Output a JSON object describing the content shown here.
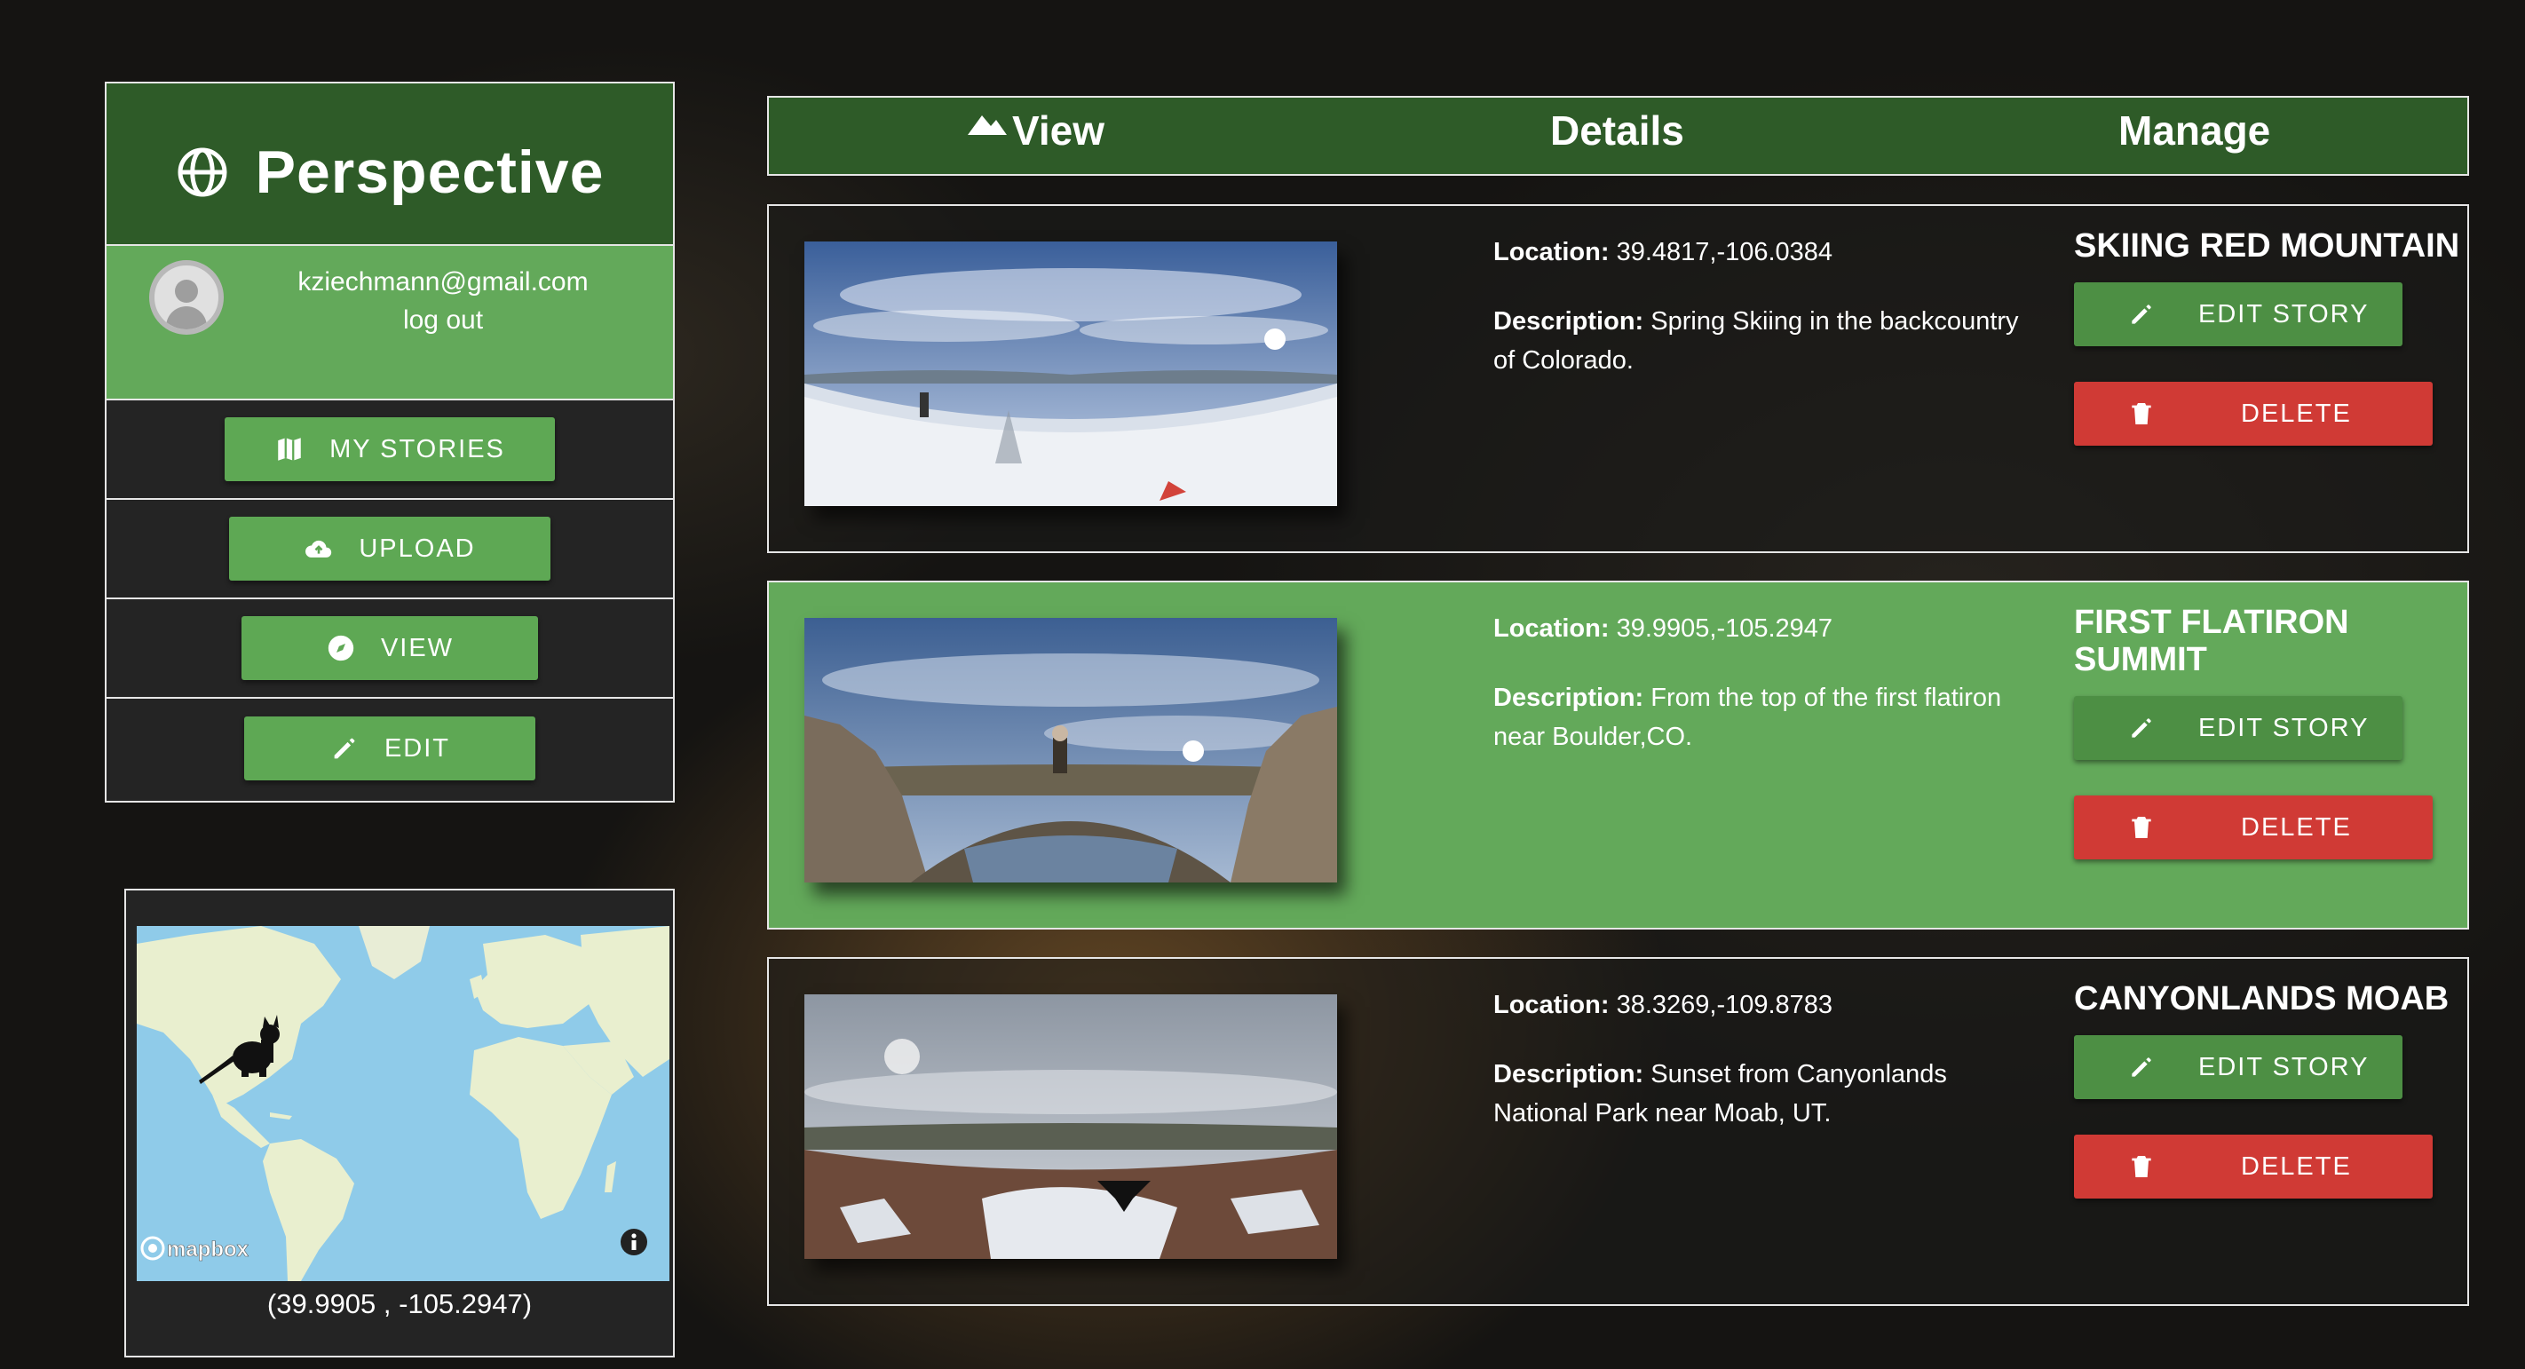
{
  "app": {
    "title": "Perspective"
  },
  "user": {
    "email": "kziechmann@gmail.com",
    "logout_label": "log out"
  },
  "nav": [
    {
      "label": "MY STORIES",
      "icon": "map-icon"
    },
    {
      "label": "UPLOAD",
      "icon": "cloud-upload-icon"
    },
    {
      "label": "VIEW",
      "icon": "compass-icon"
    },
    {
      "label": "EDIT",
      "icon": "pencil-icon"
    }
  ],
  "map": {
    "attribution": "mapbox",
    "coords_text": "(39.9905 , -105.2947)",
    "marker_icon": "cat-marker-icon"
  },
  "header": {
    "view_label": "View",
    "view_icon": "mountain-icon",
    "details_label": "Details",
    "manage_label": "Manage"
  },
  "labels": {
    "location": "Location:",
    "description": "Description:",
    "edit_story": "EDIT STORY",
    "delete": "DELETE"
  },
  "stories": [
    {
      "title": "SKIING RED MOUNTAIN",
      "location": "39.4817,-106.0384",
      "description": "Spring Skiing in the backcountry of Colorado.",
      "highlighted": false
    },
    {
      "title": "FIRST FLATIRON SUMMIT",
      "location": "39.9905,-105.2947",
      "description": "From the top of the first flatiron near Boulder,CO.",
      "highlighted": true
    },
    {
      "title": "CANYONLANDS MOAB",
      "location": "38.3269,-109.8783",
      "description": "Sunset from Canyonlands National Park near Moab, UT.",
      "highlighted": false
    }
  ],
  "colors": {
    "dark_green": "#2e5b28",
    "light_green": "#63a95a",
    "button_green": "#5ea854",
    "delete_red": "#d03a35"
  }
}
